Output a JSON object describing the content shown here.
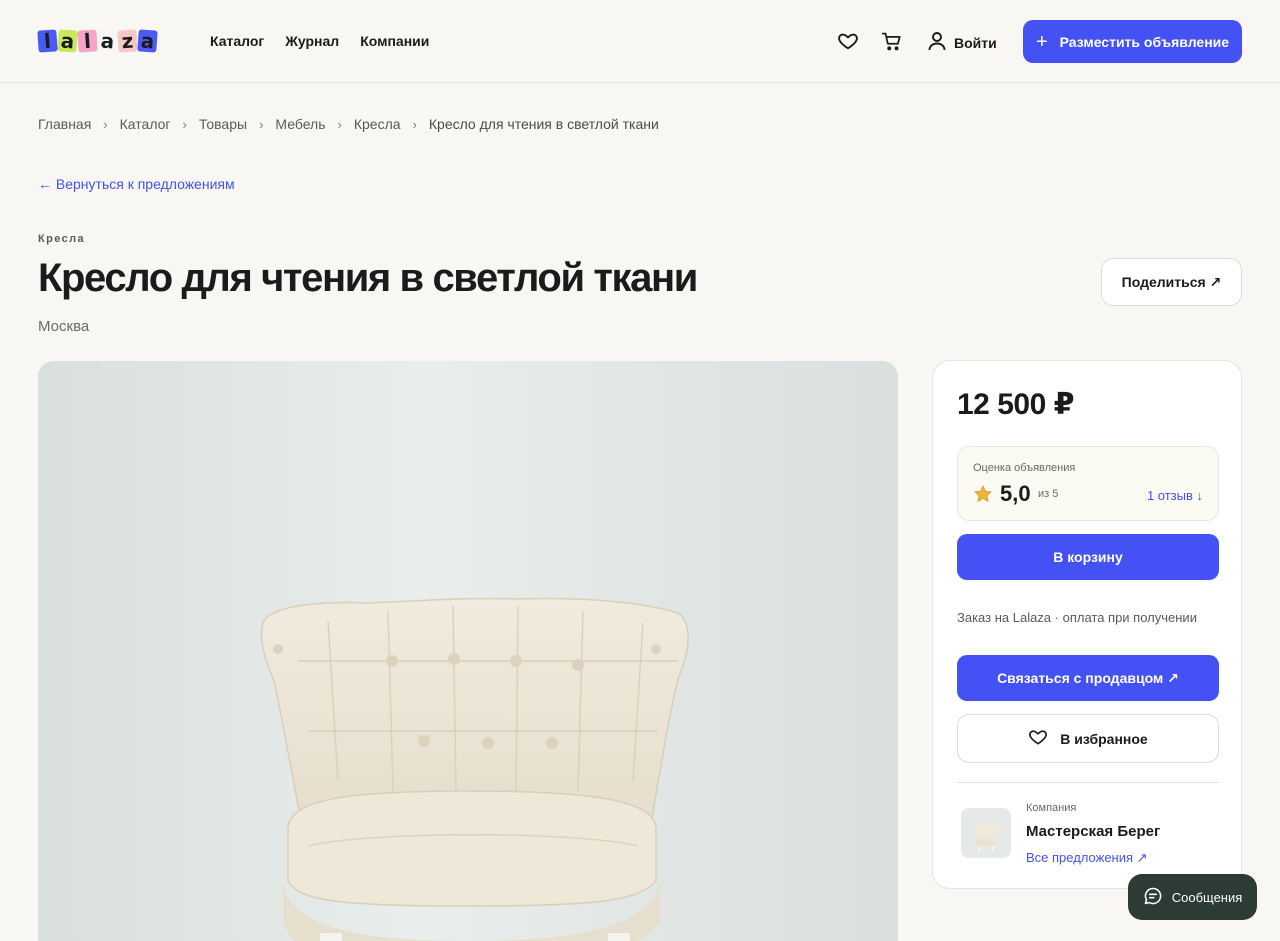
{
  "header": {
    "logo_letters": [
      "l",
      "a",
      "l",
      "a",
      "z",
      "a"
    ],
    "logo_colors": [
      "#4a5af6",
      "#c7e85a",
      "#f4a5c8",
      "#f6f6f6",
      "#f8c7c7",
      "#4a5af6"
    ],
    "nav": [
      "Каталог",
      "Журнал",
      "Компании"
    ],
    "login_label": "Войти",
    "post_label": "Разместить объявление",
    "post_icon": "+"
  },
  "breadcrumb": [
    "Главная",
    "Каталог",
    "Товары",
    "Мебель",
    "Кресла",
    "Кресло для чтения в светлой ткани"
  ],
  "breadcrumb_separator": "›",
  "back_link": "← Вернуться к предложениям",
  "listing": {
    "category": "Кресла",
    "title": "Кресло для чтения в светлой ткани",
    "city": "Москва",
    "share_label": "Поделиться ↗"
  },
  "card": {
    "price": "12 500 ₽",
    "rating_label": "Оценка объявления",
    "rating_score": "5,0",
    "rating_of": "из 5",
    "reviews_link": "1 отзыв ↓",
    "cart_label": "В корзину",
    "order_note": "Заказ на Lalaza · оплата при получении",
    "contact_label": "Связаться с продавцом ↗",
    "favorite_label": "В избранное",
    "company_label": "Компания",
    "company_name": "Мастерская Берег",
    "company_link": "Все предложения ↗"
  },
  "messages_label": "Сообщения",
  "colors": {
    "accent": "#4452f5",
    "background": "#f8f7f3",
    "messages_bg": "#2c3b33",
    "star": "#f0b43c"
  },
  "icons": [
    "heart-icon",
    "cart-icon",
    "user-icon",
    "plus-icon",
    "star-icon",
    "chat-icon"
  ]
}
